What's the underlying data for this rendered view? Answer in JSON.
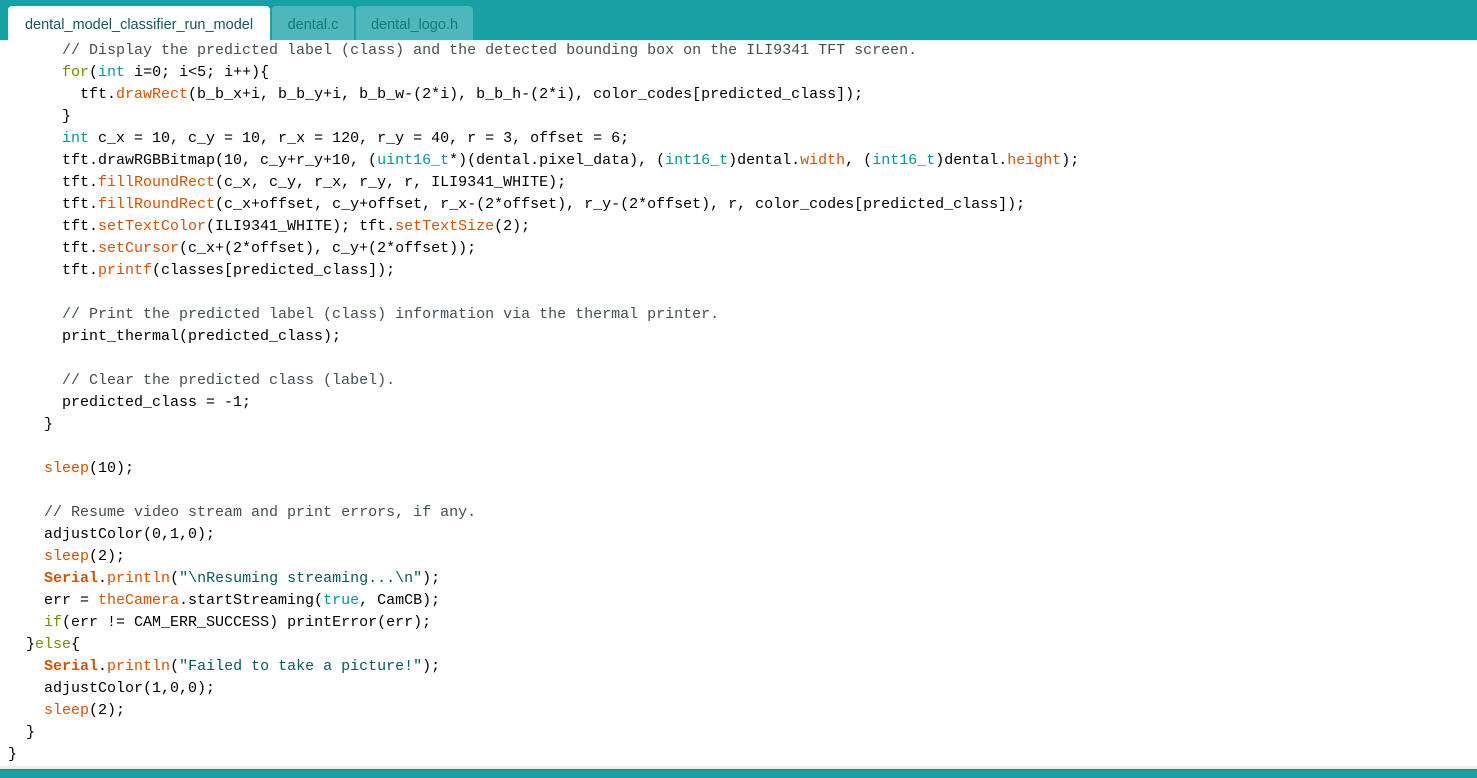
{
  "tabs": [
    {
      "label": "dental_model_classifier_run_model",
      "active": true
    },
    {
      "label": "dental.c",
      "active": false
    },
    {
      "label": "dental_logo.h",
      "active": false
    }
  ],
  "colors": {
    "brand_teal": "#17a1a5",
    "inactive_tab": "#4db7bb",
    "comment": "#434f54",
    "keyword": "#00979c",
    "control": "#728e00",
    "function": "#d35400",
    "string": "#005c5f"
  },
  "code_lines": [
    [
      {
        "t": "      "
      },
      {
        "t": "// Display the predicted label (class) and the detected bounding box on the ILI9341 TFT screen.",
        "c": "cmt"
      }
    ],
    [
      {
        "t": "      "
      },
      {
        "t": "for",
        "c": "ctl"
      },
      {
        "t": "("
      },
      {
        "t": "int",
        "c": "kw"
      },
      {
        "t": " i=0; i<5; i++){"
      }
    ],
    [
      {
        "t": "        tft."
      },
      {
        "t": "drawRect",
        "c": "fn"
      },
      {
        "t": "(b_b_x+i, b_b_y+i, b_b_w-(2*i), b_b_h-(2*i), color_codes[predicted_class]);"
      }
    ],
    [
      {
        "t": "      }"
      }
    ],
    [
      {
        "t": "      "
      },
      {
        "t": "int",
        "c": "kw"
      },
      {
        "t": " c_x = 10, c_y = 10, r_x = 120, r_y = 40, r = 3, offset = 6;"
      }
    ],
    [
      {
        "t": "      tft.drawRGBBitmap(10, c_y+r_y+10, ("
      },
      {
        "t": "uint16_t",
        "c": "kw"
      },
      {
        "t": "*)(dental.pixel_data), ("
      },
      {
        "t": "int16_t",
        "c": "kw"
      },
      {
        "t": ")dental."
      },
      {
        "t": "width",
        "c": "fn"
      },
      {
        "t": ", ("
      },
      {
        "t": "int16_t",
        "c": "kw"
      },
      {
        "t": ")dental."
      },
      {
        "t": "height",
        "c": "fn"
      },
      {
        "t": ");"
      }
    ],
    [
      {
        "t": "      tft."
      },
      {
        "t": "fillRoundRect",
        "c": "fn"
      },
      {
        "t": "(c_x, c_y, r_x, r_y, r, ILI9341_WHITE);"
      }
    ],
    [
      {
        "t": "      tft."
      },
      {
        "t": "fillRoundRect",
        "c": "fn"
      },
      {
        "t": "(c_x+offset, c_y+offset, r_x-(2*offset), r_y-(2*offset), r, color_codes[predicted_class]);"
      }
    ],
    [
      {
        "t": "      tft."
      },
      {
        "t": "setTextColor",
        "c": "fn"
      },
      {
        "t": "(ILI9341_WHITE); tft."
      },
      {
        "t": "setTextSize",
        "c": "fn"
      },
      {
        "t": "(2);"
      }
    ],
    [
      {
        "t": "      tft."
      },
      {
        "t": "setCursor",
        "c": "fn"
      },
      {
        "t": "(c_x+(2*offset), c_y+(2*offset));"
      }
    ],
    [
      {
        "t": "      tft."
      },
      {
        "t": "printf",
        "c": "fn"
      },
      {
        "t": "(classes[predicted_class]);"
      }
    ],
    [
      {
        "t": ""
      }
    ],
    [
      {
        "t": "      "
      },
      {
        "t": "// Print the predicted label (class) information via the thermal printer.",
        "c": "cmt"
      }
    ],
    [
      {
        "t": "      print_thermal(predicted_class);"
      }
    ],
    [
      {
        "t": ""
      }
    ],
    [
      {
        "t": "      "
      },
      {
        "t": "// Clear the predicted class (label).",
        "c": "cmt"
      }
    ],
    [
      {
        "t": "      predicted_class = -1;"
      }
    ],
    [
      {
        "t": "    }"
      }
    ],
    [
      {
        "t": ""
      }
    ],
    [
      {
        "t": "    "
      },
      {
        "t": "sleep",
        "c": "fn"
      },
      {
        "t": "(10);"
      }
    ],
    [
      {
        "t": ""
      }
    ],
    [
      {
        "t": "    "
      },
      {
        "t": "// Resume video stream and print errors, if any.",
        "c": "cmt"
      }
    ],
    [
      {
        "t": "    adjustColor(0,1,0);"
      }
    ],
    [
      {
        "t": "    "
      },
      {
        "t": "sleep",
        "c": "fn"
      },
      {
        "t": "(2);"
      }
    ],
    [
      {
        "t": "    "
      },
      {
        "t": "Serial",
        "c": "cls"
      },
      {
        "t": "."
      },
      {
        "t": "println",
        "c": "fn"
      },
      {
        "t": "("
      },
      {
        "t": "\"\\nResuming streaming...\\n\"",
        "c": "str"
      },
      {
        "t": ");"
      }
    ],
    [
      {
        "t": "    err = "
      },
      {
        "t": "theCamera",
        "c": "fn"
      },
      {
        "t": ".startStreaming("
      },
      {
        "t": "true",
        "c": "kw"
      },
      {
        "t": ", CamCB);"
      }
    ],
    [
      {
        "t": "    "
      },
      {
        "t": "if",
        "c": "ctl"
      },
      {
        "t": "(err != CAM_ERR_SUCCESS) printError(err);"
      }
    ],
    [
      {
        "t": "  }"
      },
      {
        "t": "else",
        "c": "ctl"
      },
      {
        "t": "{"
      }
    ],
    [
      {
        "t": "    "
      },
      {
        "t": "Serial",
        "c": "cls"
      },
      {
        "t": "."
      },
      {
        "t": "println",
        "c": "fn"
      },
      {
        "t": "("
      },
      {
        "t": "\"Failed to take a picture!\"",
        "c": "str"
      },
      {
        "t": ");"
      }
    ],
    [
      {
        "t": "    adjustColor(1,0,0);"
      }
    ],
    [
      {
        "t": "    "
      },
      {
        "t": "sleep",
        "c": "fn"
      },
      {
        "t": "(2);"
      }
    ],
    [
      {
        "t": "  }"
      }
    ],
    [
      {
        "t": "}"
      }
    ]
  ]
}
